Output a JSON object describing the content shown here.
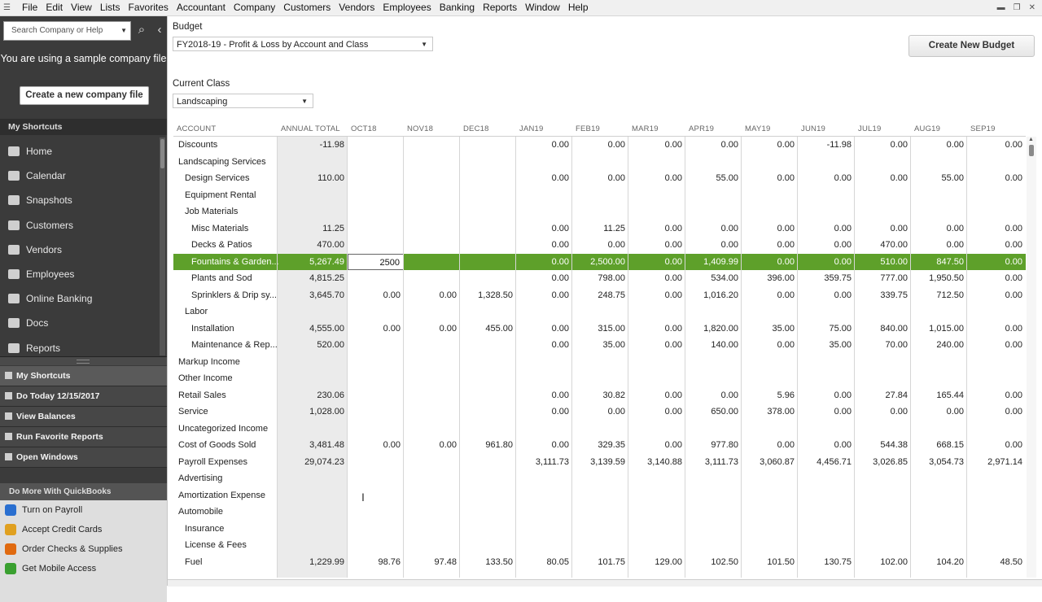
{
  "menu": [
    "File",
    "Edit",
    "View",
    "Lists",
    "Favorites",
    "Accountant",
    "Company",
    "Customers",
    "Vendors",
    "Employees",
    "Banking",
    "Reports",
    "Window",
    "Help"
  ],
  "sidebar": {
    "search_placeholder": "Search Company or Help",
    "sample_notice": "You are using a sample company file",
    "create_company_label": "Create a new company file",
    "my_shortcuts_header": "My Shortcuts",
    "nav_items": [
      "Home",
      "Calendar",
      "Snapshots",
      "Customers",
      "Vendors",
      "Employees",
      "Online Banking",
      "Docs",
      "Reports"
    ],
    "nav_icons": [
      "home-icon",
      "calendar-icon",
      "snapshots-icon",
      "customers-icon",
      "vendors-icon",
      "employees-icon",
      "bank-icon",
      "docs-icon",
      "reports-icon"
    ],
    "bottom_panels": [
      "My Shortcuts",
      "Do Today 12/15/2017",
      "View Balances",
      "Run Favorite Reports",
      "Open Windows"
    ],
    "do_more_header": "Do More With QuickBooks",
    "do_more_items": [
      {
        "label": "Turn on Payroll",
        "color": "#2a6fd0",
        "icon": "payroll-icon"
      },
      {
        "label": "Accept Credit Cards",
        "color": "#e0a020",
        "icon": "credit-card-icon"
      },
      {
        "label": "Order Checks & Supplies",
        "color": "#e06a10",
        "icon": "checks-icon"
      },
      {
        "label": "Get Mobile Access",
        "color": "#3aa030",
        "icon": "plus-icon"
      }
    ]
  },
  "budget": {
    "budget_label": "Budget",
    "budget_selected": "FY2018-19 - Profit & Loss by Account and Class",
    "create_button": "Create New Budget",
    "class_label": "Current Class",
    "class_selected": "Landscaping"
  },
  "grid": {
    "headers": [
      "ACCOUNT",
      "ANNUAL TOTAL",
      "OCT18",
      "NOV18",
      "DEC18",
      "JAN19",
      "FEB19",
      "MAR19",
      "APR19",
      "MAY19",
      "JUN19",
      "JUL19",
      "AUG19",
      "SEP19"
    ],
    "rows": [
      {
        "account": "Discounts",
        "indent": 0,
        "values": [
          "-11.98",
          "",
          "",
          "",
          "0.00",
          "0.00",
          "0.00",
          "0.00",
          "0.00",
          "-11.98",
          "0.00",
          "0.00",
          "0.00"
        ]
      },
      {
        "account": "Landscaping Services",
        "indent": 0,
        "values": [
          "",
          "",
          "",
          "",
          "",
          "",
          "",
          "",
          "",
          "",
          "",
          "",
          ""
        ]
      },
      {
        "account": "Design Services",
        "indent": 1,
        "values": [
          "110.00",
          "",
          "",
          "",
          "0.00",
          "0.00",
          "0.00",
          "55.00",
          "0.00",
          "0.00",
          "0.00",
          "55.00",
          "0.00"
        ]
      },
      {
        "account": "Equipment Rental",
        "indent": 1,
        "values": [
          "",
          "",
          "",
          "",
          "",
          "",
          "",
          "",
          "",
          "",
          "",
          "",
          ""
        ]
      },
      {
        "account": "Job Materials",
        "indent": 1,
        "values": [
          "",
          "",
          "",
          "",
          "",
          "",
          "",
          "",
          "",
          "",
          "",
          "",
          ""
        ]
      },
      {
        "account": "Misc Materials",
        "indent": 2,
        "values": [
          "11.25",
          "",
          "",
          "",
          "0.00",
          "11.25",
          "0.00",
          "0.00",
          "0.00",
          "0.00",
          "0.00",
          "0.00",
          "0.00"
        ]
      },
      {
        "account": "Decks & Patios",
        "indent": 2,
        "values": [
          "470.00",
          "",
          "",
          "",
          "0.00",
          "0.00",
          "0.00",
          "0.00",
          "0.00",
          "0.00",
          "470.00",
          "0.00",
          "0.00"
        ]
      },
      {
        "account": "Fountains & Garden...",
        "indent": 2,
        "selected": true,
        "values": [
          "5,267.49",
          "2500",
          "",
          "",
          "0.00",
          "2,500.00",
          "0.00",
          "1,409.99",
          "0.00",
          "0.00",
          "510.00",
          "847.50",
          "0.00"
        ]
      },
      {
        "account": "Plants and Sod",
        "indent": 2,
        "values": [
          "4,815.25",
          "",
          "",
          "",
          "0.00",
          "798.00",
          "0.00",
          "534.00",
          "396.00",
          "359.75",
          "777.00",
          "1,950.50",
          "0.00"
        ]
      },
      {
        "account": "Sprinklers & Drip sy...",
        "indent": 2,
        "values": [
          "3,645.70",
          "0.00",
          "0.00",
          "1,328.50",
          "0.00",
          "248.75",
          "0.00",
          "1,016.20",
          "0.00",
          "0.00",
          "339.75",
          "712.50",
          "0.00"
        ]
      },
      {
        "account": "Labor",
        "indent": 1,
        "values": [
          "",
          "",
          "",
          "",
          "",
          "",
          "",
          "",
          "",
          "",
          "",
          "",
          ""
        ]
      },
      {
        "account": "Installation",
        "indent": 2,
        "values": [
          "4,555.00",
          "0.00",
          "0.00",
          "455.00",
          "0.00",
          "315.00",
          "0.00",
          "1,820.00",
          "35.00",
          "75.00",
          "840.00",
          "1,015.00",
          "0.00"
        ]
      },
      {
        "account": "Maintenance & Rep...",
        "indent": 2,
        "values": [
          "520.00",
          "",
          "",
          "",
          "0.00",
          "35.00",
          "0.00",
          "140.00",
          "0.00",
          "35.00",
          "70.00",
          "240.00",
          "0.00"
        ]
      },
      {
        "account": "Markup Income",
        "indent": 0,
        "values": [
          "",
          "",
          "",
          "",
          "",
          "",
          "",
          "",
          "",
          "",
          "",
          "",
          ""
        ]
      },
      {
        "account": "Other Income",
        "indent": 0,
        "values": [
          "",
          "",
          "",
          "",
          "",
          "",
          "",
          "",
          "",
          "",
          "",
          "",
          ""
        ]
      },
      {
        "account": "Retail Sales",
        "indent": 0,
        "values": [
          "230.06",
          "",
          "",
          "",
          "0.00",
          "30.82",
          "0.00",
          "0.00",
          "5.96",
          "0.00",
          "27.84",
          "165.44",
          "0.00"
        ]
      },
      {
        "account": "Service",
        "indent": 0,
        "values": [
          "1,028.00",
          "",
          "",
          "",
          "0.00",
          "0.00",
          "0.00",
          "650.00",
          "378.00",
          "0.00",
          "0.00",
          "0.00",
          "0.00"
        ]
      },
      {
        "account": "Uncategorized Income",
        "indent": 0,
        "values": [
          "",
          "",
          "",
          "",
          "",
          "",
          "",
          "",
          "",
          "",
          "",
          "",
          ""
        ]
      },
      {
        "account": "Cost of Goods Sold",
        "indent": 0,
        "values": [
          "3,481.48",
          "0.00",
          "0.00",
          "961.80",
          "0.00",
          "329.35",
          "0.00",
          "977.80",
          "0.00",
          "0.00",
          "544.38",
          "668.15",
          "0.00"
        ]
      },
      {
        "account": "Payroll Expenses",
        "indent": 0,
        "values": [
          "29,074.23",
          "",
          "",
          "",
          "3,111.73",
          "3,139.59",
          "3,140.88",
          "3,111.73",
          "3,060.87",
          "4,456.71",
          "3,026.85",
          "3,054.73",
          "2,971.14"
        ]
      },
      {
        "account": "Advertising",
        "indent": 0,
        "values": [
          "",
          "",
          "",
          "",
          "",
          "",
          "",
          "",
          "",
          "",
          "",
          "",
          ""
        ]
      },
      {
        "account": "Amortization Expense",
        "indent": 0,
        "values": [
          "",
          "",
          "",
          "",
          "",
          "",
          "",
          "",
          "",
          "",
          "",
          "",
          ""
        ]
      },
      {
        "account": "Automobile",
        "indent": 0,
        "values": [
          "",
          "",
          "",
          "",
          "",
          "",
          "",
          "",
          "",
          "",
          "",
          "",
          ""
        ]
      },
      {
        "account": "Insurance",
        "indent": 1,
        "values": [
          "",
          "",
          "",
          "",
          "",
          "",
          "",
          "",
          "",
          "",
          "",
          "",
          ""
        ]
      },
      {
        "account": "License & Fees",
        "indent": 1,
        "values": [
          "",
          "",
          "",
          "",
          "",
          "",
          "",
          "",
          "",
          "",
          "",
          "",
          ""
        ]
      },
      {
        "account": "Fuel",
        "indent": 1,
        "values": [
          "1,229.99",
          "98.76",
          "97.48",
          "133.50",
          "80.05",
          "101.75",
          "129.00",
          "102.50",
          "101.50",
          "130.75",
          "102.00",
          "104.20",
          "48.50"
        ]
      }
    ]
  },
  "colors": {
    "selected_row": "#5ea02a",
    "sidebar_bg": "#3b3b3b"
  }
}
